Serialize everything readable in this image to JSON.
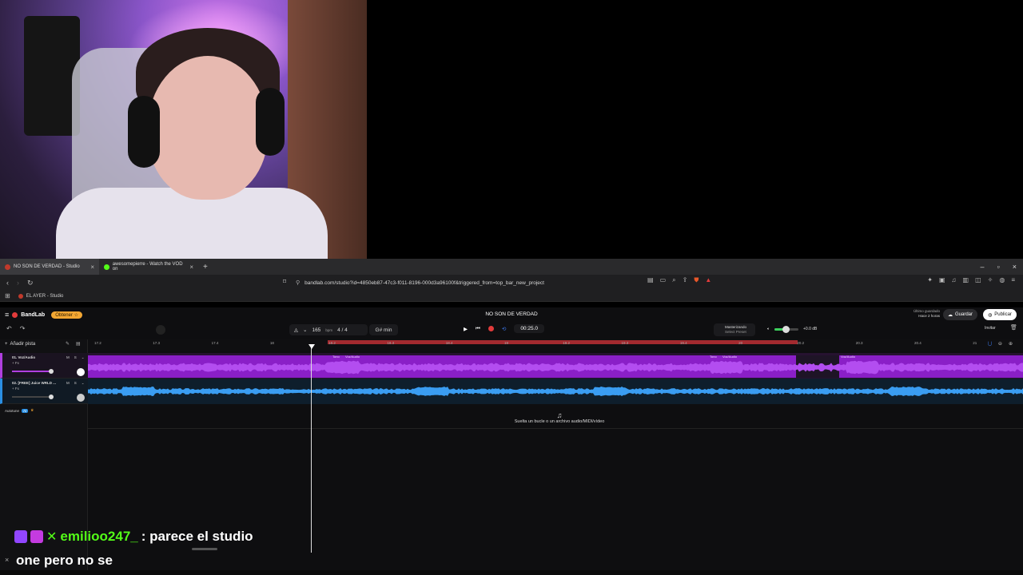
{
  "browser": {
    "tabs": [
      {
        "label": "NO SON DE VERDAD - Studio",
        "active": true,
        "color": "#c0392b"
      },
      {
        "label": "awesomepierre - Watch the VOD on",
        "active": false,
        "color": "#53fc18"
      }
    ],
    "url": "bandlab.com/studio?id=4850eb87-47c3-f011-8196-000d3a96100f&triggered_from=top_bar_new_project",
    "bookmark": "EL AYER - Studio"
  },
  "studio": {
    "brand": "BandLab",
    "obtener": "Obtener ☆",
    "project_title": "NO SON DE VERDAD",
    "saved_label": "Último guardado",
    "saved_when": "Hace 2 horas",
    "guardar": "Guardar",
    "publicar": "Publicar",
    "bpm": "165",
    "bpm_unit": "bpm",
    "meter": "4 / 4",
    "key": "G# min",
    "time": "00:25.0",
    "master_title": "Masterizando",
    "master_preset": "Select Preset",
    "volume_db": "+0.0 dB",
    "volume_level": 0.45,
    "invitar": "Invitar",
    "add_track": "Añadir pista",
    "autotune": "Autotune",
    "autotune_badge": "AI",
    "drop_hint": "Suelta un bucle o un archivo audio/MIDI/vídeo",
    "ruler_ticks": [
      "17.2",
      "17.3",
      "17.4",
      "18",
      "18.2",
      "18.3",
      "18.4",
      "19",
      "19.2",
      "19.3",
      "19.4",
      "20",
      "20.2",
      "20.3",
      "20.4",
      "21"
    ],
    "tracks": [
      {
        "name": "01. Voz/Audio",
        "fx": "+ Fx",
        "m": "M",
        "s": "S",
        "color": "#b03fe0",
        "clip_label": "Voz/Audio",
        "clip_label2": "Voz/Audio",
        "clip_label3": "Voz/Audio",
        "clip_tag": "Tono"
      },
      {
        "name": "02. [FREE] Juice WRLD ...",
        "fx": "+ Fx",
        "m": "M",
        "s": "S",
        "color": "#2a8fe3"
      }
    ]
  },
  "overlay": {
    "chat_user": "emilioo247_",
    "chat_message": ": parece el studio",
    "caption": "one pero no se"
  }
}
